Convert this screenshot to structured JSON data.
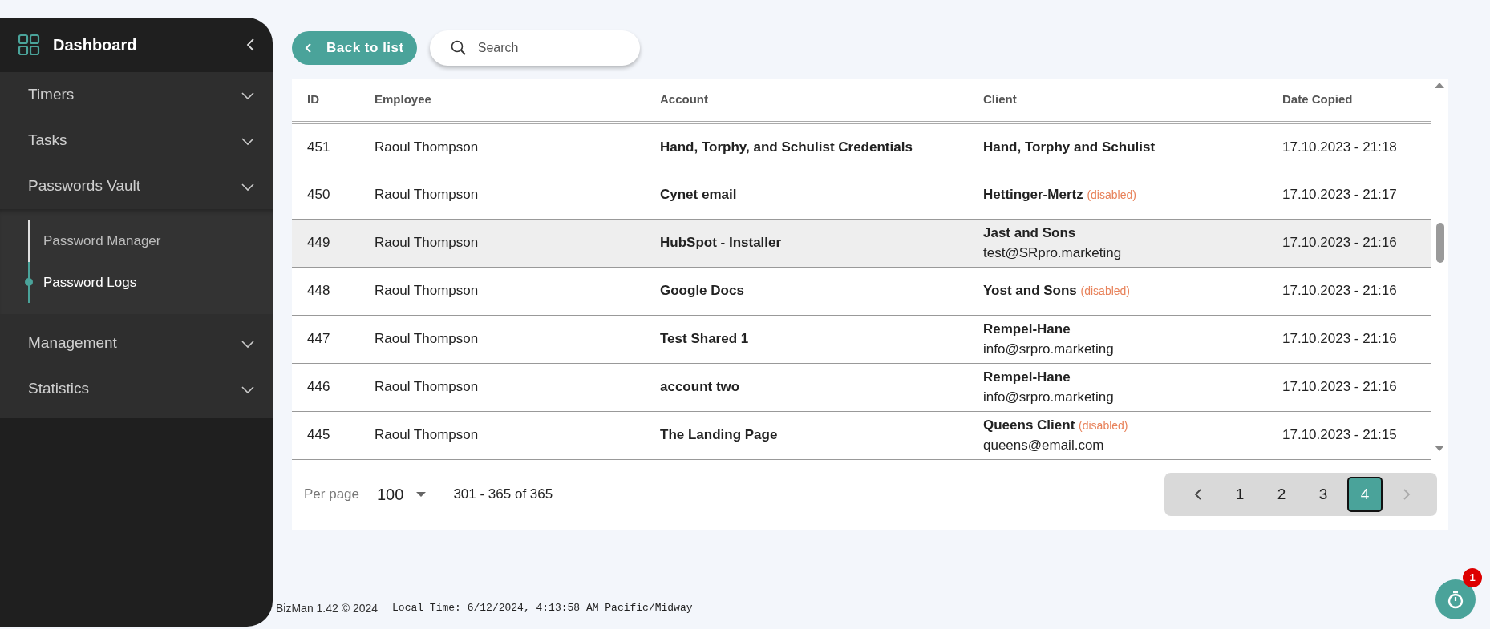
{
  "sidebar": {
    "title": "Dashboard",
    "items": [
      {
        "label": "Timers"
      },
      {
        "label": "Tasks"
      },
      {
        "label": "Passwords Vault",
        "children": [
          {
            "label": "Password Manager",
            "selected": false
          },
          {
            "label": "Password Logs",
            "selected": true
          }
        ]
      },
      {
        "label": "Management"
      },
      {
        "label": "Statistics"
      }
    ]
  },
  "toolbar": {
    "back_button": "Back to list",
    "search": {
      "placeholder": "Search"
    }
  },
  "table": {
    "columns": [
      "ID",
      "Employee",
      "Account",
      "Client",
      "Date Copied"
    ],
    "rows": [
      {
        "id": "451",
        "employee": "Raoul Thompson",
        "account": "Hand, Torphy, and Schulist Credentials",
        "client": "Hand, Torphy and Schulist",
        "date": "17.10.2023 - 21:18",
        "selected": false
      },
      {
        "id": "450",
        "employee": "Raoul Thompson",
        "account": "Cynet email",
        "client": "Hettinger-Mertz",
        "disabled_label": "(disabled)",
        "date": "17.10.2023 - 21:17",
        "selected": false
      },
      {
        "id": "449",
        "employee": "Raoul Thompson",
        "account": "HubSpot - Installer",
        "client": "Jast and Sons",
        "email": "test@SRpro.marketing",
        "date": "17.10.2023 - 21:16",
        "selected": true
      },
      {
        "id": "448",
        "employee": "Raoul Thompson",
        "account": "Google Docs",
        "client": "Yost and Sons",
        "disabled_label": "(disabled)",
        "date": "17.10.2023 - 21:16",
        "selected": false
      },
      {
        "id": "447",
        "employee": "Raoul Thompson",
        "account": "Test Shared 1",
        "client": "Rempel-Hane",
        "email": "info@srpro.marketing",
        "date": "17.10.2023 - 21:16",
        "selected": false
      },
      {
        "id": "446",
        "employee": "Raoul Thompson",
        "account": "account two",
        "client": "Rempel-Hane",
        "email": "info@srpro.marketing",
        "date": "17.10.2023 - 21:16",
        "selected": false
      },
      {
        "id": "445",
        "employee": "Raoul Thompson",
        "account": "The Landing Page",
        "client": "Queens Client",
        "disabled_label": "(disabled)",
        "email": "queens@email.com",
        "date": "17.10.2023 - 21:15",
        "selected": false
      }
    ]
  },
  "pagination": {
    "per_page_label": "Per page",
    "per_page": "100",
    "range": "301 - 365 of 365",
    "prev_disabled": false,
    "next_disabled": true,
    "pages": [
      {
        "label": "1",
        "selected": false
      },
      {
        "label": "2",
        "selected": false
      },
      {
        "label": "3",
        "selected": false
      },
      {
        "label": "4",
        "selected": true
      }
    ]
  },
  "footer": {
    "version": "BizMan 1.42 © 2024",
    "local_time": "Local Time: 6/12/2024, 4:13:58 AM Pacific/Midway"
  },
  "timer_button": {
    "badge": "1"
  }
}
